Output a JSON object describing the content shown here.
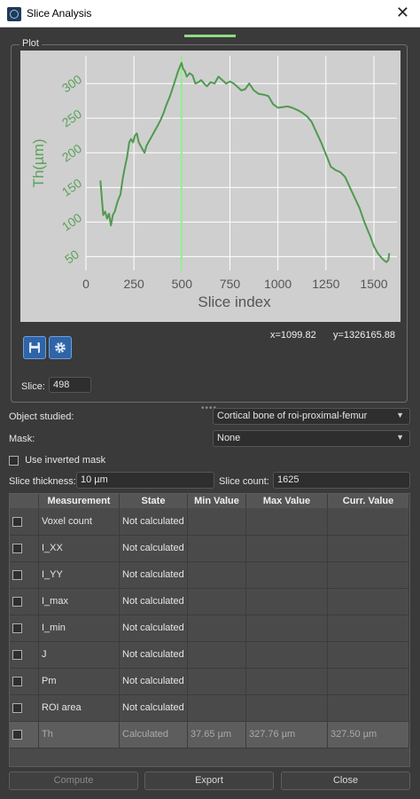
{
  "window": {
    "title": "Slice Analysis"
  },
  "plot": {
    "group_title": "Plot",
    "coord_x": "x=1099.82",
    "coord_y": "y=1326165.88",
    "slice_label": "Slice:",
    "slice_value": "498"
  },
  "chart_data": {
    "type": "line",
    "xlabel": "Slice index",
    "ylabel": "Th(µm)",
    "xlim": [
      0,
      1620
    ],
    "ylim": [
      30,
      340
    ],
    "xticks": [
      "0",
      "250",
      "500",
      "750",
      "1000",
      "1250",
      "1500"
    ],
    "yticks": [
      "50",
      "100",
      "150",
      "200",
      "250",
      "300"
    ],
    "grid": true,
    "line_color": "#4f9a4f",
    "marker_x": 498,
    "marker_color": "#8ff08b",
    "series": [
      {
        "x": [
          75,
          90,
          100,
          110,
          120,
          130,
          140,
          150,
          165,
          180,
          190,
          200,
          215,
          225,
          235,
          245,
          255,
          265,
          275,
          285,
          295,
          305,
          315,
          325,
          335,
          345,
          355,
          365,
          375,
          390,
          405,
          420,
          435,
          450,
          465,
          480,
          490,
          498,
          505,
          515,
          525,
          540,
          555,
          570,
          585,
          600,
          615,
          630,
          650,
          670,
          690,
          710,
          730,
          750,
          770,
          790,
          810,
          830,
          850,
          875,
          900,
          925,
          950,
          975,
          1000,
          1025,
          1050,
          1075,
          1100,
          1125,
          1150,
          1175,
          1200,
          1225,
          1250,
          1275,
          1300,
          1325,
          1350,
          1375,
          1400,
          1425,
          1450,
          1465,
          1480,
          1500,
          1520,
          1540,
          1555,
          1565,
          1575,
          1580
        ],
        "y": [
          160,
          110,
          115,
          105,
          112,
          95,
          110,
          115,
          130,
          140,
          160,
          175,
          195,
          215,
          220,
          215,
          225,
          228,
          215,
          210,
          205,
          200,
          210,
          215,
          220,
          225,
          230,
          235,
          240,
          248,
          258,
          270,
          280,
          292,
          305,
          318,
          325,
          330,
          322,
          318,
          310,
          315,
          312,
          300,
          302,
          305,
          300,
          296,
          302,
          300,
          310,
          305,
          300,
          303,
          300,
          295,
          290,
          292,
          300,
          290,
          285,
          284,
          282,
          270,
          265,
          266,
          267,
          265,
          262,
          258,
          253,
          245,
          230,
          215,
          198,
          180,
          175,
          172,
          165,
          150,
          135,
          120,
          100,
          90,
          80,
          65,
          55,
          48,
          44,
          42,
          45,
          55
        ]
      }
    ]
  },
  "form": {
    "object_label": "Object studied:",
    "object_value": "Cortical bone of roi-proximal-femur",
    "mask_label": "Mask:",
    "mask_value": "None",
    "inverted_label": "Use inverted mask",
    "thickness_label": "Slice thickness:",
    "thickness_value": "10 µm",
    "count_label": "Slice count:",
    "count_value": "1625"
  },
  "table": {
    "headers": [
      "Measurement",
      "State",
      "Min Value",
      "Max Value",
      "Curr. Value"
    ],
    "rows": [
      {
        "measurement": "Voxel count",
        "state": "Not calculated",
        "min": "",
        "max": "",
        "curr": ""
      },
      {
        "measurement": "I_XX",
        "state": "Not calculated",
        "min": "",
        "max": "",
        "curr": ""
      },
      {
        "measurement": "I_YY",
        "state": "Not calculated",
        "min": "",
        "max": "",
        "curr": ""
      },
      {
        "measurement": "I_max",
        "state": "Not calculated",
        "min": "",
        "max": "",
        "curr": ""
      },
      {
        "measurement": "I_min",
        "state": "Not calculated",
        "min": "",
        "max": "",
        "curr": ""
      },
      {
        "measurement": "J",
        "state": "Not calculated",
        "min": "",
        "max": "",
        "curr": ""
      },
      {
        "measurement": "Pm",
        "state": "Not calculated",
        "min": "",
        "max": "",
        "curr": ""
      },
      {
        "measurement": "ROI area",
        "state": "Not calculated",
        "min": "",
        "max": "",
        "curr": ""
      },
      {
        "measurement": "Th",
        "state": "Calculated",
        "min": "37.65 µm",
        "max": "327.76 µm",
        "curr": "327.50 µm"
      }
    ]
  },
  "buttons": {
    "compute": "Compute",
    "export": "Export",
    "close": "Close"
  },
  "icons": {
    "save": "save-icon",
    "settings": "gear-icon",
    "close": "close-icon"
  }
}
